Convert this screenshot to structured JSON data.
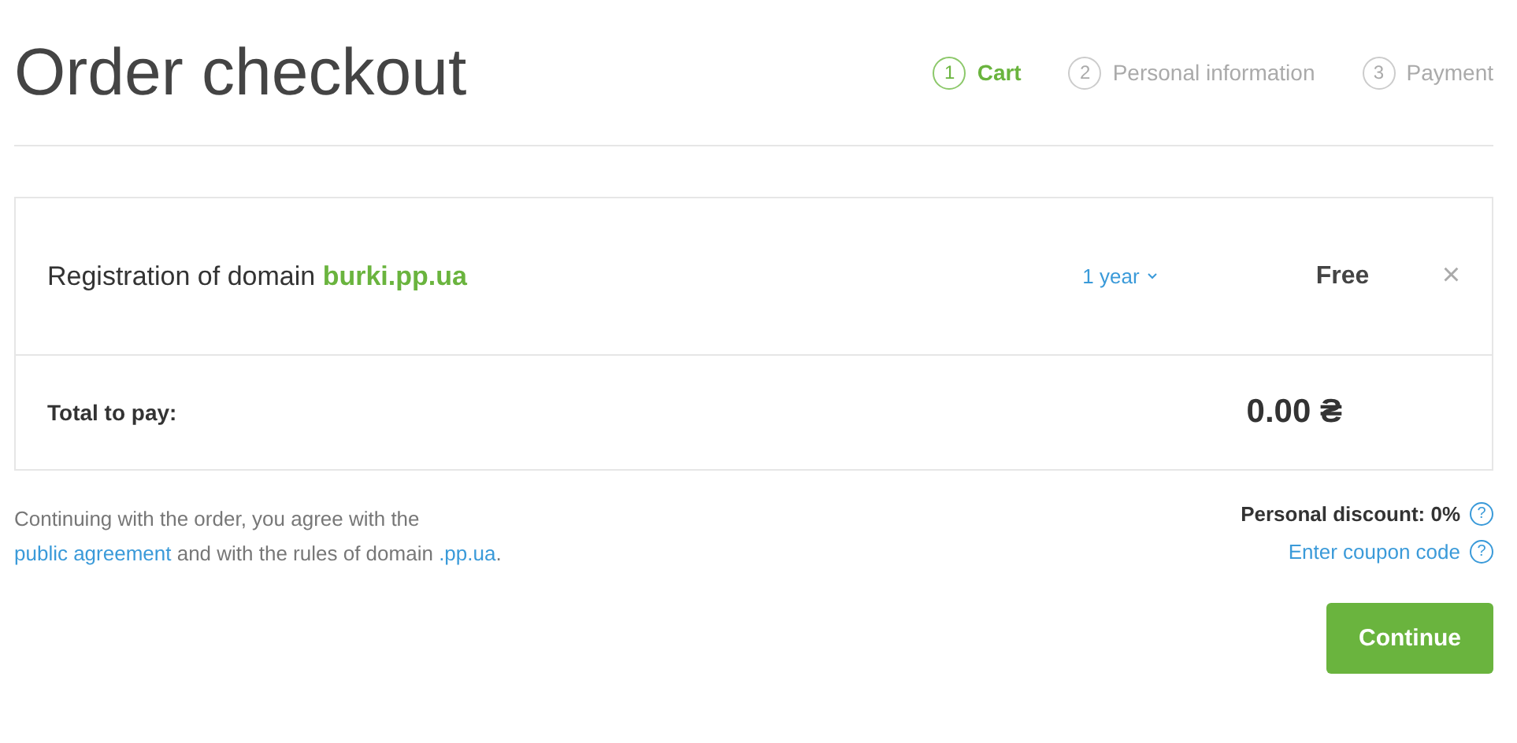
{
  "title": "Order checkout",
  "steps": [
    {
      "number": "1",
      "label": "Cart",
      "selected": true
    },
    {
      "number": "2",
      "label": "Personal information",
      "selected": false
    },
    {
      "number": "3",
      "label": "Payment",
      "selected": false
    }
  ],
  "order_item": {
    "description": "Registration of domain",
    "domain": "burki.pp.ua",
    "period": "1 year",
    "price": "Free",
    "remove": "×"
  },
  "total": {
    "label": "Total to pay:",
    "amount": "0.00 ₴"
  },
  "agreement": [
    {
      "kind": "text",
      "text": "Continuing with the order, you agree with the "
    },
    {
      "kind": "link",
      "text": "public agreement"
    },
    {
      "kind": "text",
      "text": " and with the rules of domain "
    },
    {
      "kind": "link",
      "text": ".pp.ua"
    },
    {
      "kind": "text",
      "text": "."
    }
  ],
  "discount": {
    "label": "Personal discount: 0%",
    "help": "?"
  },
  "coupon": {
    "label": "Enter coupon code",
    "help": "?"
  },
  "continue_button": "Continue"
}
